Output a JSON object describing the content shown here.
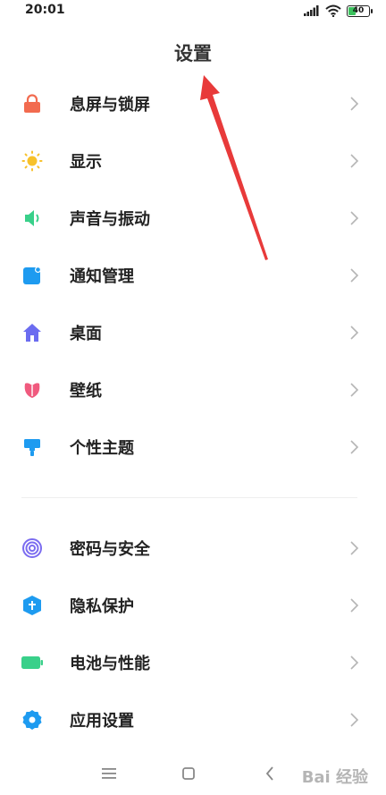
{
  "status_bar": {
    "time": "20:01",
    "battery_level": 40,
    "battery_label": "40"
  },
  "header": {
    "title": "设置"
  },
  "items": [
    {
      "label": "息屏与锁屏",
      "icon": "lock-icon",
      "color": "#f26b4f"
    },
    {
      "label": "显示",
      "icon": "sun-icon",
      "color": "#f7c12b"
    },
    {
      "label": "声音与振动",
      "icon": "speaker-icon",
      "color": "#39d08a"
    },
    {
      "label": "通知管理",
      "icon": "notification-icon",
      "color": "#1e9bf0"
    },
    {
      "label": "桌面",
      "icon": "home-icon",
      "color": "#6b6cf0"
    },
    {
      "label": "壁纸",
      "icon": "tulip-icon",
      "color": "#f05a7e"
    },
    {
      "label": "个性主题",
      "icon": "brush-icon",
      "color": "#1e9bf0"
    },
    {
      "label": "密码与安全",
      "icon": "fingerprint-icon",
      "color": "#7b6cf0"
    },
    {
      "label": "隐私保护",
      "icon": "shield-icon",
      "color": "#1e9bf0"
    },
    {
      "label": "电池与性能",
      "icon": "battery-icon",
      "color": "#39d08a"
    },
    {
      "label": "应用设置",
      "icon": "gear-icon",
      "color": "#1e9bf0"
    }
  ],
  "watermark": "Bai 经验"
}
